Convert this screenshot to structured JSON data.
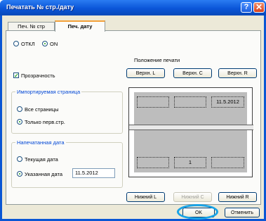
{
  "window": {
    "title": "Печатать № стр./дату"
  },
  "tabs": [
    {
      "label": "Печ. № стр"
    },
    {
      "label": "Печ. дату"
    }
  ],
  "toggle": {
    "off_label": "ОТКЛ",
    "on_label": "ON",
    "selected": "ON"
  },
  "position": {
    "title": "Положение печати"
  },
  "transparency": {
    "label": "Прозрачность",
    "checked": true
  },
  "top_buttons": {
    "left": "Верхн. L",
    "center": "Верхн. С",
    "right": "Верхн. R"
  },
  "bottom_buttons": {
    "left": "Нижний L",
    "center": "Нижний С",
    "right": "Нижний R"
  },
  "imported_page": {
    "title": "Импортируемая страница",
    "all_pages": "Все страницы",
    "first_only": "Только перв.стр.",
    "selected": "first_only"
  },
  "printed_date": {
    "title": "Напечатанная дата",
    "current": "Текущая дата",
    "specified": "Указанная дата",
    "value": "11.5.2012",
    "selected": "specified"
  },
  "preview": {
    "date_text": "11.5.2012",
    "page_number": "1"
  },
  "footer": {
    "ok_label": "OK",
    "cancel_label": "Отменить"
  },
  "colors": {
    "titlebar": "#0a55d8",
    "highlight_ring": "#1aa3e6",
    "group_title": "#0046d5"
  }
}
